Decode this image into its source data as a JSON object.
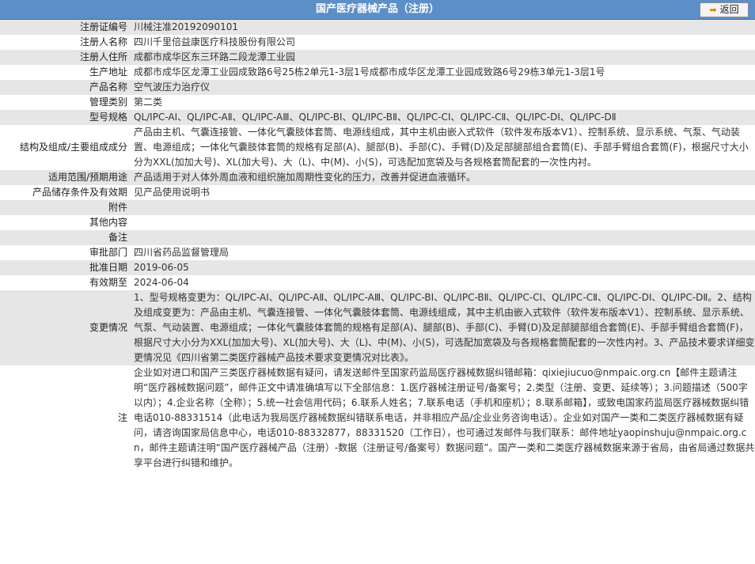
{
  "header": {
    "title": "国产医疗器械产品（注册）",
    "back_label": "返回"
  },
  "rows": [
    {
      "label": "注册证编号",
      "value": "川械注准20192090101"
    },
    {
      "label": "注册人名称",
      "value": "四川千里倍益康医疗科技股份有限公司"
    },
    {
      "label": "注册人住所",
      "value": "成都市成华区东三环路二段龙潭工业园"
    },
    {
      "label": "生产地址",
      "value": "成都市成华区龙潭工业园成致路6号25栋2单元1-3层1号成都市成华区龙潭工业园成致路6号29栋3单元1-3层1号"
    },
    {
      "label": "产品名称",
      "value": "空气波压力治疗仪"
    },
    {
      "label": "管理类别",
      "value": "第二类"
    },
    {
      "label": "型号规格",
      "value": "QL/IPC-AⅠ、QL/IPC-AⅡ、QL/IPC-AⅢ、QL/IPC-BⅠ、QL/IPC-BⅡ、QL/IPC-CⅠ、QL/IPC-CⅡ、QL/IPC-DⅠ、QL/IPC-DⅡ"
    },
    {
      "label": "结构及组成/主要组成成分",
      "value": "产品由主机、气囊连接管、一体化气囊肢体套筒、电源线组成，其中主机由嵌入式软件（软件发布版本V1）、控制系统、显示系统、气泵、气动装置、电源组成；一体化气囊肢体套筒的规格有足部(A)、腿部(B)、手部(C)、手臂(D)及足部腿部组合套筒(E)、手部手臂组合套筒(F)，根据尺寸大小分为XXL(加加大号)、XL(加大号)、大（L)、中(M)、小(S)，可选配加宽袋及与各规格套筒配套的一次性内衬。"
    },
    {
      "label": "适用范围/预期用途",
      "value": "产品适用于对人体外周血液和组织施加周期性变化的压力，改善并促进血液循环。"
    },
    {
      "label": "产品储存条件及有效期",
      "value": "见产品使用说明书"
    },
    {
      "label": "附件",
      "value": ""
    },
    {
      "label": "其他内容",
      "value": ""
    },
    {
      "label": "备注",
      "value": ""
    },
    {
      "label": "审批部门",
      "value": "四川省药品监督管理局"
    },
    {
      "label": "批准日期",
      "value": "2019-06-05"
    },
    {
      "label": "有效期至",
      "value": "2024-06-04"
    },
    {
      "label": "变更情况",
      "value": "1、型号规格变更为：QL/IPC-AⅠ、QL/IPC-AⅡ、QL/IPC-AⅢ、QL/IPC-BⅠ、QL/IPC-BⅡ、QL/IPC-CⅠ、QL/IPC-CⅡ、QL/IPC-DⅠ、QL/IPC-DⅡ。2、结构及组成变更为：产品由主机、气囊连接管、一体化气囊肢体套筒、电源线组成，其中主机由嵌入式软件（软件发布版本V1）、控制系统、显示系统、气泵、气动装置、电源组成；一体化气囊肢体套筒的规格有足部(A)、腿部(B)、手部(C)、手臂(D)及足部腿部组合套筒(E)、手部手臂组合套筒(F)，根据尺寸大小分为XXL(加加大号)、XL(加大号)、大（L)、中(M)、小(S)，可选配加宽袋及与各规格套筒配套的一次性内衬。3、产品技术要求详细变更情况见《四川省第二类医疗器械产品技术要求变更情况对比表》。"
    },
    {
      "label": "注",
      "value": "企业如对进口和国产三类医疗器械数据有疑问，请发送邮件至国家药监局医疗器械数据纠错邮箱：qixiejiucuo@nmpaic.org.cn【邮件主题请注明“医疗器械数据问题”，邮件正文中请准确填写以下全部信息：1.医疗器械注册证号/备案号；2.类型（注册、变更、延续等）；3.问题描述（500字以内）；4.企业名称（全称）；5.统一社会信用代码；6.联系人姓名；7.联系电话（手机和座机）；8.联系邮箱】，或致电国家药监局医疗器械数据纠错电话010-88331514（此电话为我局医疗器械数据纠错联系电话，并非相应产品/企业业务咨询电话）。企业如对国产一类和二类医疗器械数据有疑问，请咨询国家局信息中心，电话010-88332877，88331520（工作日），也可通过发邮件与我们联系：邮件地址yaopinshuju@nmpaic.org.cn，邮件主题请注明“国产医疗器械产品（注册）-数据（注册证号/备案号）数据问题”。国产一类和二类医疗器械数据来源于省局，由省局通过数据共享平台进行纠错和维护。"
    }
  ]
}
